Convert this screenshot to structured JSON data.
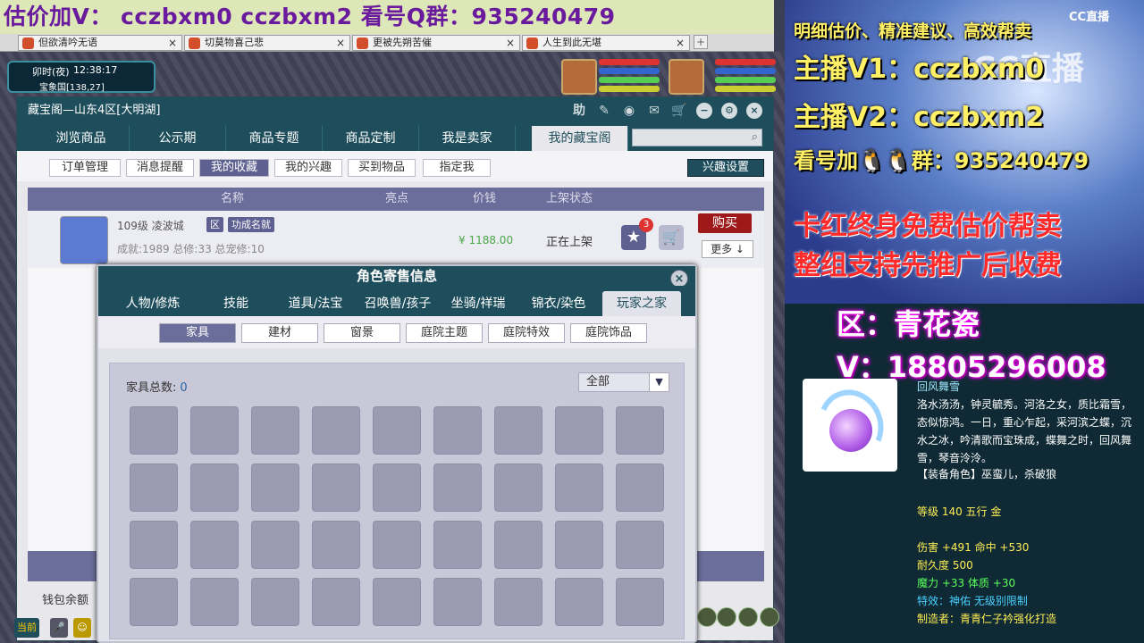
{
  "stream_banner": {
    "text": "估价加V： cczbxm0   cczbxm2   看号Q群：935240479"
  },
  "browser_tabs": [
    {
      "label": "但欲清吟无语"
    },
    {
      "label": "切莫物喜己悲"
    },
    {
      "label": "更被先朔苦催"
    },
    {
      "label": "人生到此无堪"
    }
  ],
  "game_hud": {
    "time_period": "卯时(夜)",
    "clock": "12:38:17",
    "location": "宝象国[138,27]",
    "hud_left_button": "当前"
  },
  "window": {
    "title": "藏宝阁—山东4区[大明湖]",
    "help_label": "助",
    "nav_tabs": [
      {
        "label": "浏览商品"
      },
      {
        "label": "公示期"
      },
      {
        "label": "商品专题"
      },
      {
        "label": "商品定制"
      },
      {
        "label": "我是卖家"
      },
      {
        "label": "我的藏宝阁",
        "active": true
      }
    ],
    "search": {
      "value": "",
      "placeholder": ""
    },
    "sub_tabs": [
      {
        "label": "订单管理"
      },
      {
        "label": "消息提醒"
      },
      {
        "label": "我的收藏",
        "active": true
      },
      {
        "label": "我的兴趣"
      },
      {
        "label": "买到物品"
      },
      {
        "label": "指定我"
      }
    ],
    "interest_button": "兴趣设置",
    "table_headers": {
      "name": "名称",
      "highlight": "亮点",
      "price": "价钱",
      "status": "上架状态"
    },
    "row": {
      "level_server": "109级 凌波城",
      "tag1": "区",
      "tag2": "功成名就",
      "stats": "成就:1989 总修:33 总宠修:10",
      "price": "¥ 1188.00",
      "status": "正在上架",
      "star_badge": "3",
      "buy": "购买",
      "more": "更多 ↓"
    },
    "wallet_label": "钱包余额"
  },
  "dialog": {
    "title": "角色寄售信息",
    "tabs": [
      {
        "label": "人物/修炼"
      },
      {
        "label": "技能"
      },
      {
        "label": "道具/法宝"
      },
      {
        "label": "召唤兽/孩子"
      },
      {
        "label": "坐骑/祥瑞"
      },
      {
        "label": "锦衣/染色"
      },
      {
        "label": "玩家之家",
        "active": true
      }
    ],
    "sub_tabs": [
      {
        "label": "家具",
        "active": true
      },
      {
        "label": "建材"
      },
      {
        "label": "窗景"
      },
      {
        "label": "庭院主题"
      },
      {
        "label": "庭院特效"
      },
      {
        "label": "庭院饰品"
      }
    ],
    "furniture_count_label": "家具总数:",
    "furniture_count": "0",
    "filter": "全部"
  },
  "promo": {
    "line1": "明细估价、精准建议、高效帮卖",
    "line2": "主播V1：cczbxm0",
    "line3": "主播V2：cczbxm2",
    "line4": "看号加🐧🐧群：935240479",
    "line5": "卡红终身免费估价帮卖",
    "line6": "整组支持先推广后收费",
    "cc_logo": "CC直播",
    "cc_watermark": "CC直播",
    "zone": "区：青花瓷",
    "contact": "V：18805296008"
  },
  "item": {
    "name": "回风舞雪",
    "description": "洛水汤汤，钟灵毓秀。河洛之女，质比霜雪，态似惊鸿。一日，重心乍起，采河滨之蝶，沉水之冰，吟清歌而宝珠成，蝶舞之时，回风舞雪，琴音泠泠。",
    "equip_roles": "【装备角色】巫蛮儿，杀破狼",
    "level_line": "等级 140 五行 金",
    "attack_line": "伤害 +491 命中 +530",
    "durability": "耐久度 500",
    "magic_line": "魔力 +33 体质 +30",
    "special": "特效：神佑 无级别限制",
    "maker": "制造者：青青仁子衿强化打造"
  },
  "colors": {
    "accent": "#1e4e5c",
    "purple": "#6b6d9a",
    "buy_red": "#9e1a1a",
    "promo_yellow": "#fff066",
    "promo_red": "#ff2a2a"
  }
}
